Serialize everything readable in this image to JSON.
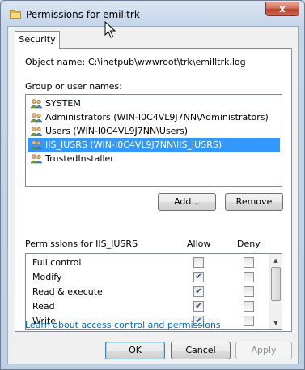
{
  "window": {
    "title": "Permissions for emilltrk",
    "close_glyph": "x"
  },
  "tab": {
    "label": "Security"
  },
  "object": {
    "label": "Object name:",
    "value": "C:\\inetpub\\wwwroot\\trk\\emilltrk.log"
  },
  "groups": {
    "label": "Group or user names:",
    "items": [
      {
        "label": "SYSTEM",
        "icon": "users-icon",
        "selected": false
      },
      {
        "label": "Administrators (WIN-I0C4VL9J7NN\\Administrators)",
        "icon": "users-icon",
        "selected": false
      },
      {
        "label": "Users (WIN-I0C4VL9J7NN\\Users)",
        "icon": "users-icon",
        "selected": false
      },
      {
        "label": "IIS_IUSRS (WIN-I0C4VL9J7NN\\IIS_IUSRS)",
        "icon": "users-icon",
        "selected": true
      },
      {
        "label": "TrustedInstaller",
        "icon": "users-icon",
        "selected": false
      }
    ],
    "add_button": "Add...",
    "remove_button": "Remove"
  },
  "permissions": {
    "label": "Permissions for IIS_IUSRS",
    "allow_header": "Allow",
    "deny_header": "Deny",
    "rows": [
      {
        "name": "Full control",
        "allow": false,
        "deny": false
      },
      {
        "name": "Modify",
        "allow": true,
        "deny": false
      },
      {
        "name": "Read & execute",
        "allow": true,
        "deny": false
      },
      {
        "name": "Read",
        "allow": true,
        "deny": false
      },
      {
        "name": "Write",
        "allow": true,
        "deny": false
      }
    ]
  },
  "link": {
    "label": "Learn about access control and permissions"
  },
  "footer": {
    "ok": "OK",
    "cancel": "Cancel",
    "apply": "Apply",
    "apply_enabled": false
  },
  "colors": {
    "selection": "#3399ff",
    "link": "#0066cc",
    "close_button": "#c7503a"
  }
}
